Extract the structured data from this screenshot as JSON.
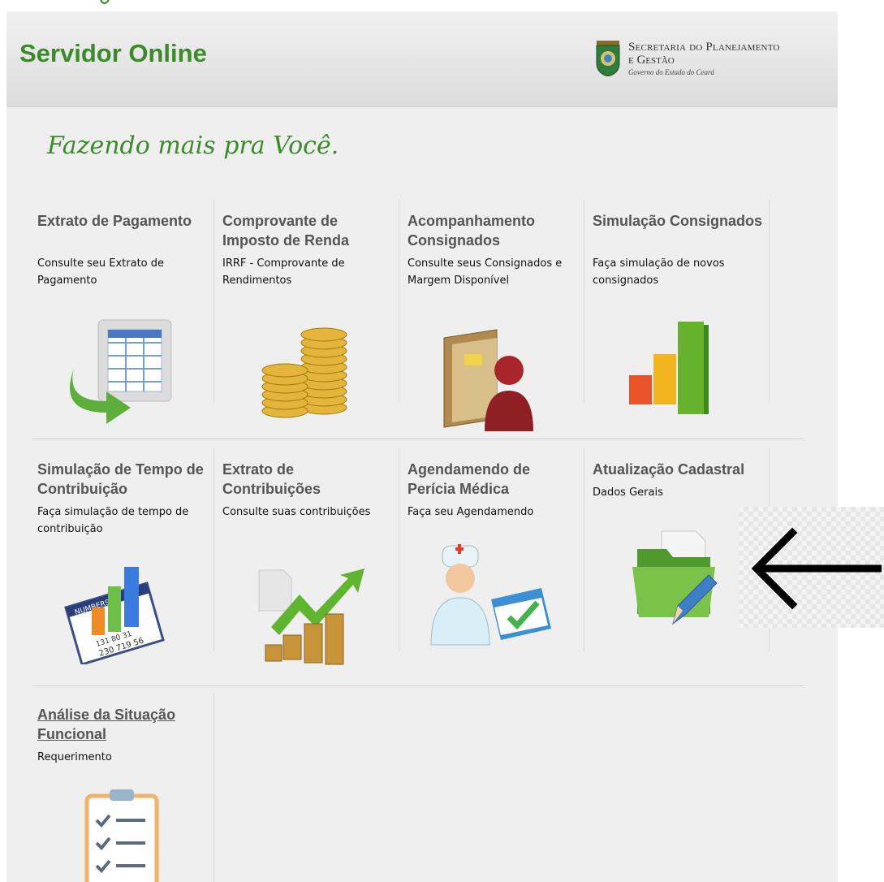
{
  "header": {
    "title": "Servidor Online",
    "brand_line1": "Secretaria do Planejamento",
    "brand_line2": "e Gestão",
    "brand_line3": "Governo do Estado do Ceará"
  },
  "tagline": "Fazendo mais pra Você.",
  "cards": [
    {
      "title": "Extrato de Pagamento",
      "desc": "Consulte seu Extrato de Pagamento",
      "icon": "spreadsheet-refresh-icon"
    },
    {
      "title": "Comprovante de Imposto de Renda",
      "desc": "IRRF - Comprovante de Rendimentos",
      "icon": "coins-icon"
    },
    {
      "title": "Acompanhamento Consignados",
      "desc": "Consulte seus Consignados e Margem Disponível",
      "icon": "folder-person-icon"
    },
    {
      "title": "Simulação Consignados",
      "desc": "Faça simulação de novos consignados",
      "icon": "bar-chart-icon"
    },
    {
      "title": "Simulação de Tempo de Contribuição",
      "desc": "Faça simulação de tempo de contribuição",
      "icon": "numbers-chart-icon"
    },
    {
      "title": "Extrato de Contribuições",
      "desc": "Consulte suas contribuições",
      "icon": "coins-growth-icon"
    },
    {
      "title": "Agendamendo de Perícia Médica",
      "desc": "Faça seu Agendamendo",
      "icon": "nurse-calendar-icon"
    },
    {
      "title": "Atualização Cadastral",
      "desc": "Dados Gerais",
      "icon": "folder-edit-icon"
    },
    {
      "title": "Análise da Situação Funcional",
      "desc": "Requerimento",
      "icon": "checklist-icon"
    }
  ],
  "icon_labels": {
    "numbers_tag": "NUMBERS",
    "numbers_row1": "131  80  31",
    "numbers_row2": "230  719  56"
  },
  "colors": {
    "green_brand": "#3b8a2c",
    "title_gray": "#555555",
    "annotation_arrow": "#000000"
  }
}
